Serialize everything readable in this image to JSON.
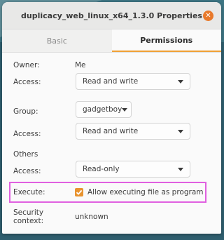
{
  "window": {
    "title": "duplicacy_web_linux_x64_1.3.0 Properties",
    "close_icon": "close-icon"
  },
  "tabs": [
    {
      "label": "Basic",
      "active": false
    },
    {
      "label": "Permissions",
      "active": true
    }
  ],
  "owner": {
    "label": "Owner:",
    "value": "Me",
    "access_label": "Access:",
    "access_value": "Read and write"
  },
  "group": {
    "label": "Group:",
    "value": "gadgetboy",
    "access_label": "Access:",
    "access_value": "Read and write"
  },
  "others": {
    "heading": "Others",
    "access_label": "Access:",
    "access_value": "Read-only"
  },
  "execute": {
    "label": "Execute:",
    "checkbox_label": "Allow executing file as program",
    "checked": true
  },
  "security": {
    "label": "Security context:",
    "value": "unknown"
  },
  "colors": {
    "accent": "#e8932f",
    "highlight": "#e060e0"
  }
}
